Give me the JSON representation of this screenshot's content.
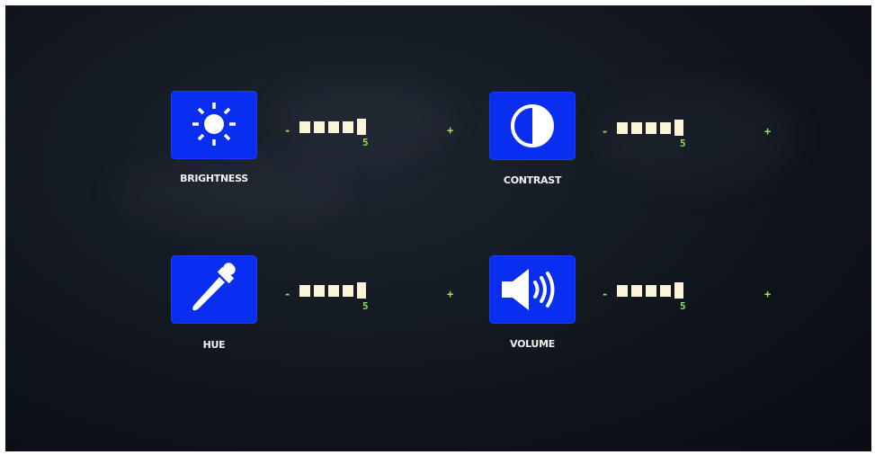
{
  "osd": {
    "controls": [
      {
        "id": "brightness",
        "label": "BRIGHTNESS",
        "icon": "sun-icon",
        "value": "5",
        "minus": "-",
        "plus": "+"
      },
      {
        "id": "contrast",
        "label": "CONTRAST",
        "icon": "contrast-icon",
        "value": "5",
        "minus": "-",
        "plus": "+"
      },
      {
        "id": "hue",
        "label": "HUE",
        "icon": "dropper-icon",
        "value": "5",
        "minus": "-",
        "plus": "+"
      },
      {
        "id": "volume",
        "label": "VOLUME",
        "icon": "speaker-icon",
        "value": "5",
        "minus": "-",
        "plus": "+"
      }
    ],
    "colors": {
      "tile": "#0a2ef0",
      "bar": "#fbf4d8",
      "accent": "#9be05a",
      "background": "#131820"
    }
  }
}
